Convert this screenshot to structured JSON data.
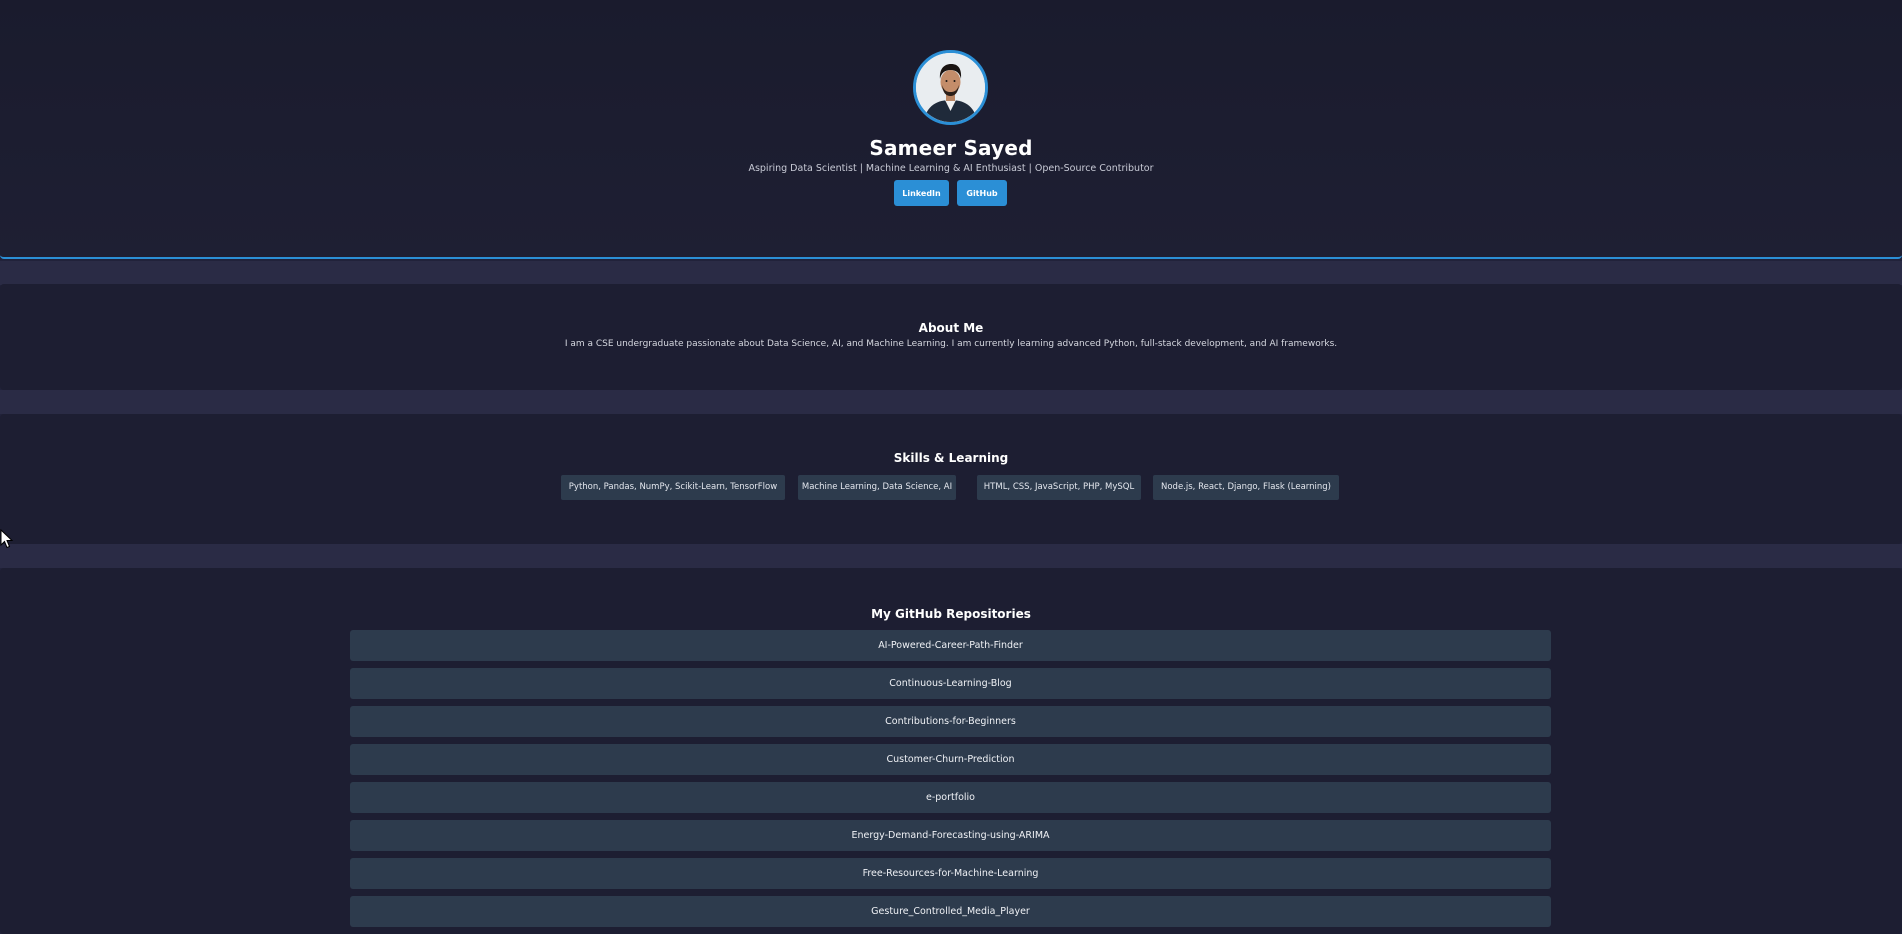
{
  "profile": {
    "name": "Sameer Sayed",
    "tagline": "Aspiring Data Scientist | Machine Learning & AI Enthusiast | Open-Source Contributor",
    "buttons": {
      "linkedin": "LinkedIn",
      "github": "GitHub"
    }
  },
  "about": {
    "title": "About Me",
    "text": "I am a CSE undergraduate passionate about Data Science, AI, and Machine Learning. I am currently learning advanced Python, full-stack development, and AI frameworks."
  },
  "skills": {
    "title": "Skills & Learning",
    "items": [
      "Python, Pandas, NumPy, Scikit-Learn, TensorFlow",
      "Machine Learning, Data Science, AI",
      "HTML, CSS, JavaScript, PHP, MySQL",
      "Node.js, React, Django, Flask (Learning)"
    ]
  },
  "repos": {
    "title": "My GitHub Repositories",
    "items": [
      "AI-Powered-Career-Path-Finder",
      "Continuous-Learning-Blog",
      "Contributions-for-Beginners",
      "Customer-Churn-Prediction",
      "e-portfolio",
      "Energy-Demand-Forecasting-using-ARIMA",
      "Free-Resources-for-Machine-Learning",
      "Gesture_Controlled_Media_Player"
    ]
  },
  "colors": {
    "accent": "#2b8fd6",
    "background": "#21223a",
    "card": "#2d3b4d"
  }
}
